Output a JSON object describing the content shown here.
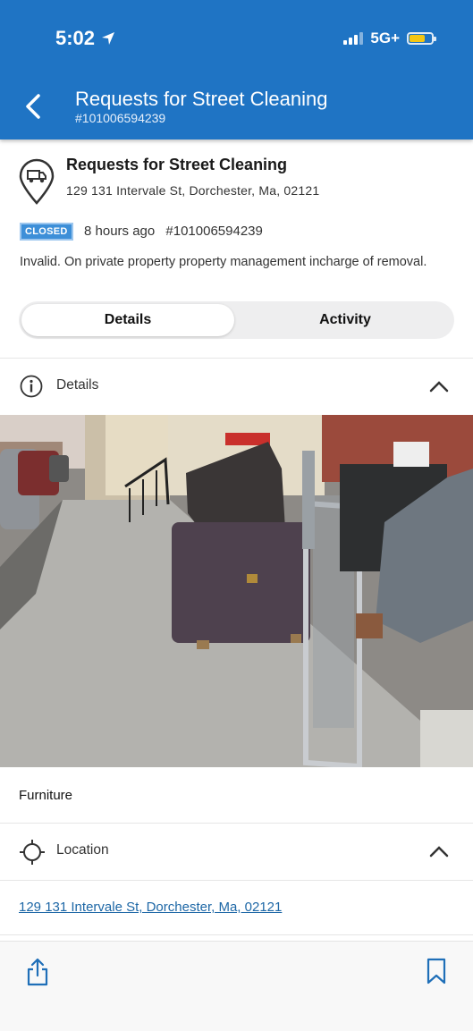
{
  "status_bar": {
    "time": "5:02",
    "network": "5G+"
  },
  "header": {
    "title": "Requests for Street Cleaning",
    "subtitle": "#101006594239"
  },
  "request": {
    "icon": "truck-pin-icon",
    "title": "Requests for Street Cleaning",
    "address": "129 131 Intervale St, Dorchester, Ma, 02121",
    "status": "CLOSED",
    "age": "8 hours ago",
    "id": "#101006594239",
    "description": "Invalid. On private property property management incharge of removal."
  },
  "tabs": {
    "details": "Details",
    "activity": "Activity",
    "selected": "Details"
  },
  "details_section": {
    "label": "Details",
    "icon": "info-icon",
    "expanded": true,
    "photo_caption": "Furniture"
  },
  "location_section": {
    "label": "Location",
    "icon": "crosshair-icon",
    "expanded": true,
    "link": "129 131 Intervale St, Dorchester, Ma, 02121"
  },
  "bottom_bar": {
    "share_icon": "share-icon",
    "bookmark_icon": "bookmark-icon"
  },
  "colors": {
    "header": "#1f74c4",
    "badge": "#3d8fd8",
    "link": "#1d67a6"
  }
}
